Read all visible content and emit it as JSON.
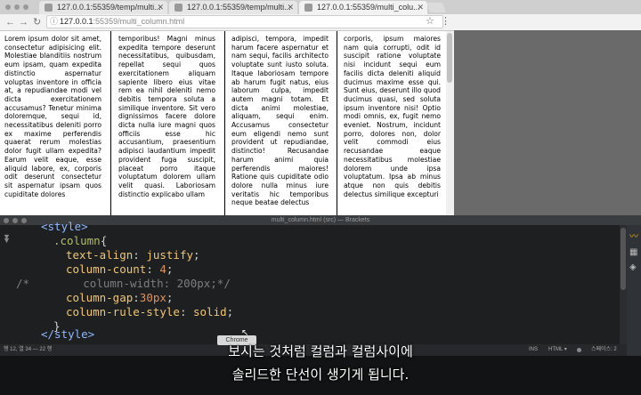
{
  "browser": {
    "tabs": [
      {
        "title": "127.0.0.1:55359/temp/multi..."
      },
      {
        "title": "127.0.0.1:55359/temp/multi..."
      },
      {
        "title": "127.0.0.1:55359/multi_colu..."
      }
    ],
    "url_host": "127.0.0.1",
    "url_rest": ":55359/multi_column.html",
    "columns": [
      "Lorem ipsum dolor sit amet, consectetur adipisicing elit. Molestiae blanditiis nostrum eum ipsam, quam expedita distinctio aspernatur voluptas inventore in officia at, a repudiandae modi vel dicta exercitationem accusamus? Tenetur minima doloremque, sequi id, necessitatibus deleniti porro ex maxime perferendis quaerat rerum molestias dolor fugit ullam expedita? Earum velit eaque, esse aliquid labore, ex, corporis odit deserunt consectetur sit aspernatur ipsam quos cupiditate dolores",
      "temporibus! Magni minus expedita tempore deserunt necessitatibus, quibusdam, repellat sequi quos exercitationem aliquam sapiente libero eius vitae rem ea nihil deleniti nemo debitis tempora soluta a similique inventore. Sit vero dignissimos facere dolore dicta nulla iure magni quos officiis esse hic accusantium, praesentium adipisci laudantium impedit provident fuga suscipit, placeat porro itaque voluptatum dolorem ullam velit quasi. Laboriosam distinctio explicabo ullam",
      "adipisci, tempora, impedit harum facere aspernatur et nam sequi, facilis architecto voluptate sunt iusto soluta. Itaque laboriosam tempore ab harum fugit natus, eius laborum culpa, impedit autem magni totam. Et dicta animi molestiae, aliquam, sequi enim. Accusamus consectetur eum eligendi nemo sunt provident ut repudiandae, distinctio! Recusandae harum animi quia perferendis maiores! Ratione quis cupiditate odio dolore nulla minus iure veritatis hic temporibus neque beatae delectus",
      "corporis, ipsum maiores nam quia corrupti, odit id suscipit ratione voluptate nisi incidunt sequi eum facilis dicta deleniti aliquid ducimus maxime esse qui. Sunt eius, deserunt illo quod ducimus quasi, sed soluta ipsum inventore nisi! Optio modi omnis, ex, fugit nemo eveniet. Nostrum, incidunt porro, dolores non, dolor velit commodi eius recusandae eaque necessitatibus molestiae dolorem unde ipsa voluptatum. Ipsa ab minus atque non quis debitis delectus similique excepturi"
    ]
  },
  "editor": {
    "title": "multi_column.html (src) — Brackets",
    "code": {
      "l1_open": "<style>",
      "l2_selector": ".column",
      "l2_brace": "{",
      "l3_prop": "text-align",
      "l3_val": "justify",
      "l4_prop": "column-count",
      "l4_val": "4",
      "l5_comment_start": "/*",
      "l5_comment_rest": "column-width: 200px;*/",
      "l6_prop": "column-gap",
      "l6_val": "30px",
      "l7_prop": "column-rule-style",
      "l7_val": "solid",
      "l8_close": "}",
      "l9_close": "</style>"
    },
    "status_left": "행 12, 열 34 — 22 행",
    "status_ins": "INS",
    "status_lang": "HTML ▾",
    "status_spaces": "스페이스: 2",
    "tooltip": "Chrome"
  },
  "subtitle": {
    "line1": "보시는 것처럼 컬럼과 컬럼사이에",
    "line2": "솔리드한 단선이 생기게 됩니다."
  }
}
